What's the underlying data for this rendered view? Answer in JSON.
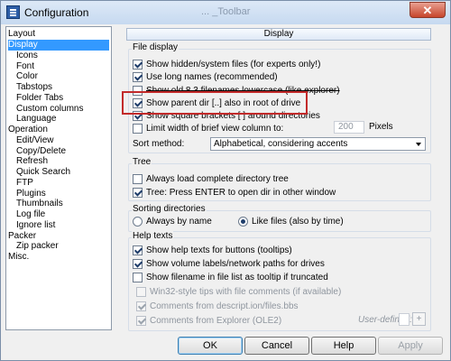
{
  "window": {
    "title": "Configuration",
    "background_title": "... _Toolbar"
  },
  "nav": {
    "items": [
      {
        "label": "Layout",
        "indent": 0
      },
      {
        "label": "Display",
        "indent": 0,
        "selected": true
      },
      {
        "label": "Icons",
        "indent": 1
      },
      {
        "label": "Font",
        "indent": 1
      },
      {
        "label": "Color",
        "indent": 1
      },
      {
        "label": "Tabstops",
        "indent": 1
      },
      {
        "label": "Folder Tabs",
        "indent": 1
      },
      {
        "label": "Custom columns",
        "indent": 1
      },
      {
        "label": "Language",
        "indent": 1
      },
      {
        "label": "Operation",
        "indent": 0
      },
      {
        "label": "Edit/View",
        "indent": 1
      },
      {
        "label": "Copy/Delete",
        "indent": 1
      },
      {
        "label": "Refresh",
        "indent": 1
      },
      {
        "label": "Quick Search",
        "indent": 1
      },
      {
        "label": "FTP",
        "indent": 1
      },
      {
        "label": "Plugins",
        "indent": 1
      },
      {
        "label": "Thumbnails",
        "indent": 1
      },
      {
        "label": "Log file",
        "indent": 1
      },
      {
        "label": "Ignore list",
        "indent": 1
      },
      {
        "label": "Packer",
        "indent": 0
      },
      {
        "label": "Zip packer",
        "indent": 1
      },
      {
        "label": "Misc.",
        "indent": 0
      }
    ]
  },
  "panel": {
    "title": "Display"
  },
  "file_display": {
    "legend": "File display",
    "options": [
      {
        "label": "Show hidden/system files (for experts only!)",
        "checked": true
      },
      {
        "label": "Use long names (recommended)",
        "checked": true
      },
      {
        "label": "Show old 8.3 filenames lowercase (like explorer)",
        "checked": false
      },
      {
        "label": "Show parent dir [..] also in root of drive",
        "checked": true
      },
      {
        "label": "Show square brackets [ ] around directories",
        "checked": true
      },
      {
        "label": "Limit width of brief view column to:",
        "checked": false
      }
    ],
    "column_width": "200",
    "column_unit": "Pixels",
    "sort_label": "Sort method:",
    "sort_value": "Alphabetical, considering accents"
  },
  "tree": {
    "legend": "Tree",
    "options": [
      {
        "label": "Always load complete directory tree",
        "checked": false
      },
      {
        "label": "Tree: Press ENTER to open dir in other window",
        "checked": true
      }
    ]
  },
  "sorting": {
    "legend": "Sorting directories",
    "options": [
      {
        "label": "Always by name",
        "selected": false
      },
      {
        "label": "Like files (also by time)",
        "selected": true
      }
    ]
  },
  "help_texts": {
    "legend": "Help texts",
    "options": [
      {
        "label": "Show help texts for buttons (tooltips)",
        "checked": true,
        "disabled": false
      },
      {
        "label": "Show volume labels/network paths for drives",
        "checked": true,
        "disabled": false
      },
      {
        "label": "Show filename in file list as tooltip if truncated",
        "checked": false,
        "disabled": false
      },
      {
        "label": "Win32-style tips with file comments (if available)",
        "checked": false,
        "disabled": true
      },
      {
        "label": "Comments from descript.ion/files.bbs",
        "checked": true,
        "disabled": true
      },
      {
        "label": "Comments from Explorer (OLE2)",
        "checked": true,
        "disabled": true
      }
    ],
    "user_defined_label": "User-defined:",
    "plus_label": "+"
  },
  "buttons": {
    "ok": "OK",
    "cancel": "Cancel",
    "help": "Help",
    "apply": "Apply"
  },
  "colors": {
    "selection": "#3399ff",
    "highlight_box": "#c22a2a",
    "close_button": "#c7452b"
  }
}
